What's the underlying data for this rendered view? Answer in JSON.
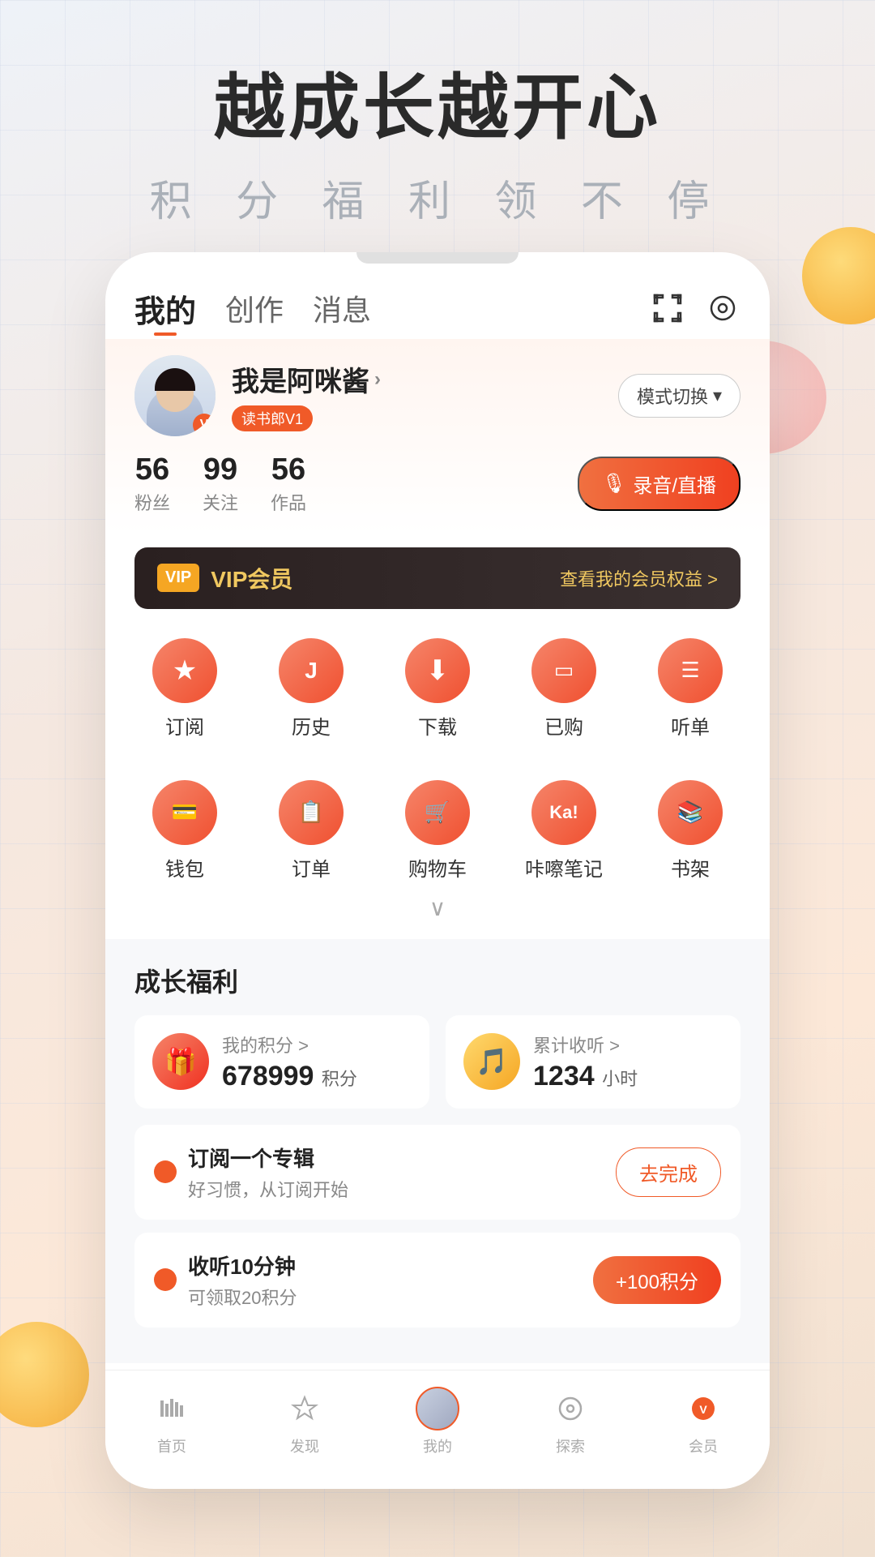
{
  "hero": {
    "title": "越成长越开心",
    "subtitle": "积 分 福 利 领 不 停"
  },
  "nav": {
    "tab_mine": "我的",
    "tab_create": "创作",
    "tab_message": "消息"
  },
  "profile": {
    "username": "我是阿咪酱",
    "badge_text": "读书郎V1",
    "mode_switch": "模式切换",
    "fans_count": "56",
    "fans_label": "粉丝",
    "follow_count": "99",
    "follow_label": "关注",
    "works_count": "56",
    "works_label": "作品",
    "record_btn": "录音/直播"
  },
  "vip": {
    "logo_text": "VIP",
    "title": "VIP会员",
    "rights_link": "查看我的会员权益 >"
  },
  "quick_icons": {
    "row1": [
      {
        "icon": "★",
        "label": "订阅"
      },
      {
        "icon": "J",
        "label": "历史"
      },
      {
        "icon": "↓",
        "label": "下载"
      },
      {
        "icon": "◻",
        "label": "已购"
      },
      {
        "icon": "≡",
        "label": "听单"
      }
    ],
    "row2": [
      {
        "icon": "👜",
        "label": "钱包"
      },
      {
        "icon": "📋",
        "label": "订单"
      },
      {
        "icon": "🛒",
        "label": "购物车"
      },
      {
        "icon": "Ka!",
        "label": "咔嚓笔记"
      },
      {
        "icon": "📚",
        "label": "书架"
      }
    ],
    "expand_label": "展开"
  },
  "growth": {
    "section_title": "成长福利",
    "points_label": "我的积分 >",
    "points_value": "678999",
    "points_unit": "积分",
    "listen_label": "累计收听 >",
    "listen_value": "1234",
    "listen_unit": "小时",
    "tasks": [
      {
        "title": "订阅一个专辑",
        "desc": "好习惯，从订阅开始",
        "btn_label": "去完成",
        "btn_type": "outline"
      },
      {
        "title": "收听10分钟",
        "desc": "可领取20积分",
        "btn_label": "+100积分",
        "btn_type": "filled"
      }
    ]
  },
  "bottom_nav": [
    {
      "icon": "📊",
      "label": "首页",
      "active": false
    },
    {
      "icon": "☆",
      "label": "发现",
      "active": false
    },
    {
      "icon": "avatar",
      "label": "我的",
      "active": false
    },
    {
      "icon": "◎",
      "label": "探索",
      "active": false
    },
    {
      "icon": "🔴",
      "label": "会员",
      "active": false
    }
  ]
}
